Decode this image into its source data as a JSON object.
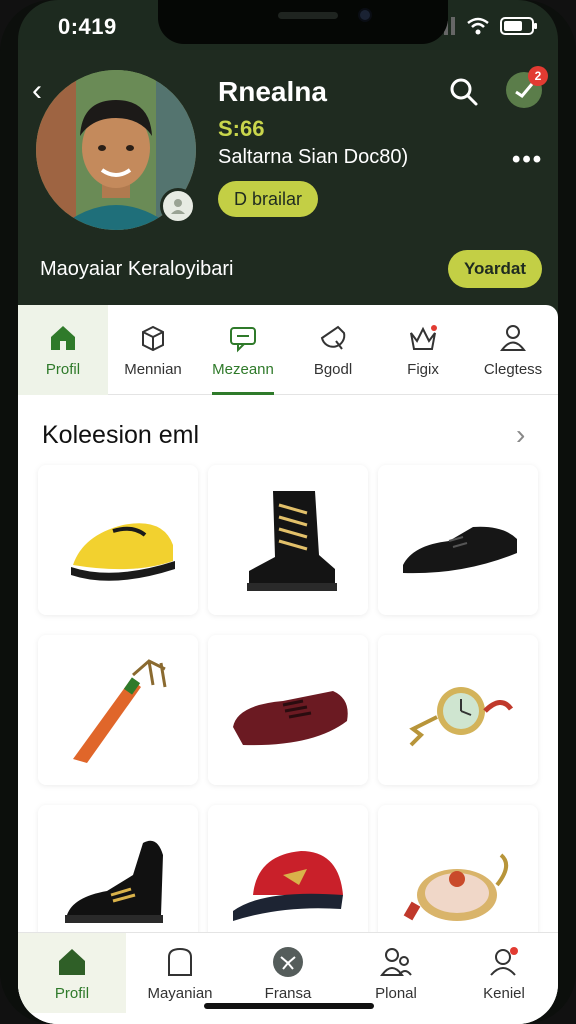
{
  "status_bar": {
    "time": "0:419"
  },
  "profile": {
    "name": "Rnealna",
    "score": "S:66",
    "subtitle": "Saltarna Sian Doc80)",
    "chip_button": "D brailar",
    "membership_text": "Maoyaiar Keraloyibari",
    "follow_button": "Yoardat",
    "notification_count": "2"
  },
  "tabs": [
    {
      "label": "Profil",
      "icon": "home-icon"
    },
    {
      "label": "Mennian",
      "icon": "box-icon"
    },
    {
      "label": "Mezeann",
      "icon": "chat-icon"
    },
    {
      "label": "Bgodl",
      "icon": "tag-icon"
    },
    {
      "label": "Figix",
      "icon": "crown-icon"
    },
    {
      "label": "Clegtess",
      "icon": "person-icon"
    }
  ],
  "collection": {
    "title": "Koleesion eml",
    "items": [
      {
        "icon": "cap-shoe-icon"
      },
      {
        "icon": "boot-icon"
      },
      {
        "icon": "loafer-icon"
      },
      {
        "icon": "rod-icon"
      },
      {
        "icon": "shoe-red-icon"
      },
      {
        "icon": "pocket-watch-icon"
      },
      {
        "icon": "dress-shoe-icon"
      },
      {
        "icon": "baseball-cap-icon"
      },
      {
        "icon": "compass-icon"
      }
    ]
  },
  "bottom_nav": [
    {
      "label": "Profil",
      "icon": "home-icon"
    },
    {
      "label": "Mayanian",
      "icon": "bag-icon"
    },
    {
      "label": "Fransa",
      "icon": "ball-icon"
    },
    {
      "label": "Plonal",
      "icon": "people-icon"
    },
    {
      "label": "Keniel",
      "icon": "person-icon"
    }
  ],
  "colors": {
    "header_bg": "#1f2b20",
    "accent": "#c3cf45",
    "active_green": "#2f7a2a",
    "badge_red": "#e23b32"
  }
}
